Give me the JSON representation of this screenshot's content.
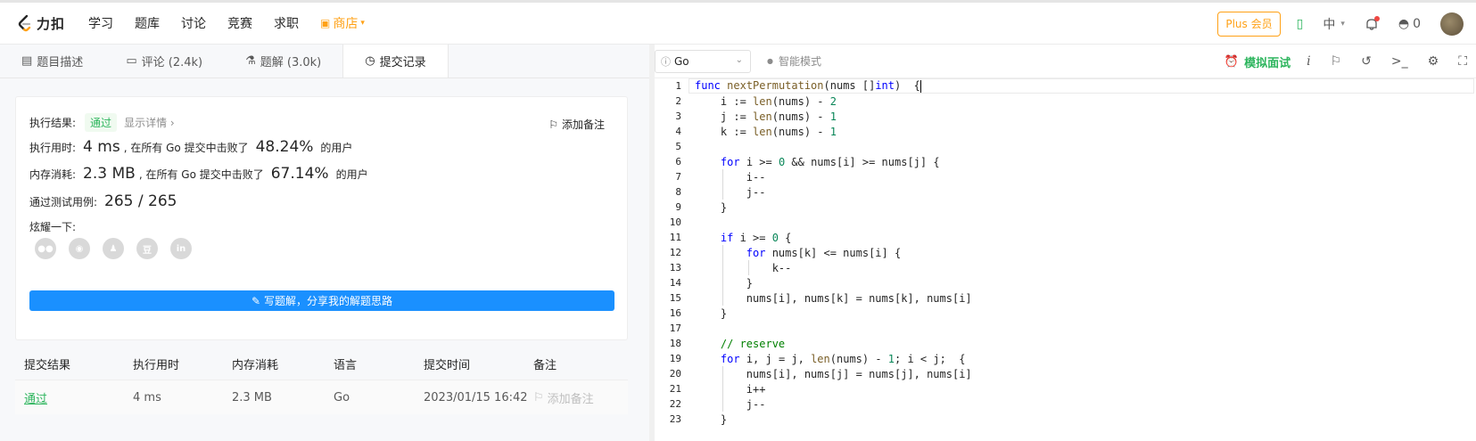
{
  "header": {
    "logo_text": "力扣",
    "nav": [
      "学习",
      "题库",
      "讨论",
      "竞赛",
      "求职"
    ],
    "shop_label": "商店",
    "plus_label": "Plus 会员",
    "lang_label": "中",
    "fire_count": "0"
  },
  "tabs": [
    {
      "label": "题目描述",
      "icon": "description-icon"
    },
    {
      "label": "评论 (2.4k)",
      "icon": "comment-icon"
    },
    {
      "label": "题解 (3.0k)",
      "icon": "flask-icon"
    },
    {
      "label": "提交记录",
      "icon": "clock-icon"
    }
  ],
  "result": {
    "status_label": "执行结果:",
    "status": "通过",
    "detail": "显示详情 ›",
    "add_note": "添加备注",
    "time_label": "执行用时:",
    "time_value": "4 ms",
    "time_text": ", 在所有 Go 提交中击败了",
    "time_pct": "48.24%",
    "users_text": "的用户",
    "mem_label": "内存消耗:",
    "mem_value": "2.3 MB",
    "mem_text": ", 在所有 Go 提交中击败了",
    "mem_pct": "67.14%",
    "cases_label": "通过测试用例:",
    "cases_value": "265 / 265",
    "share_label": "炫耀一下:",
    "write_button": "写题解，分享我的解题思路"
  },
  "table": {
    "headers": [
      "提交结果",
      "执行用时",
      "内存消耗",
      "语言",
      "提交时间",
      "备注"
    ],
    "rows": [
      {
        "result": "通过",
        "time": "4 ms",
        "memory": "2.3 MB",
        "lang": "Go",
        "submitted": "2023/01/15 16:42",
        "note": "添加备注"
      }
    ]
  },
  "editor": {
    "language": "Go",
    "smart_mode": "智能模式",
    "mock_interview": "模拟面试"
  },
  "colors": {
    "accent": "#ffa116",
    "success": "#2db55d",
    "primary": "#1a90ff"
  }
}
